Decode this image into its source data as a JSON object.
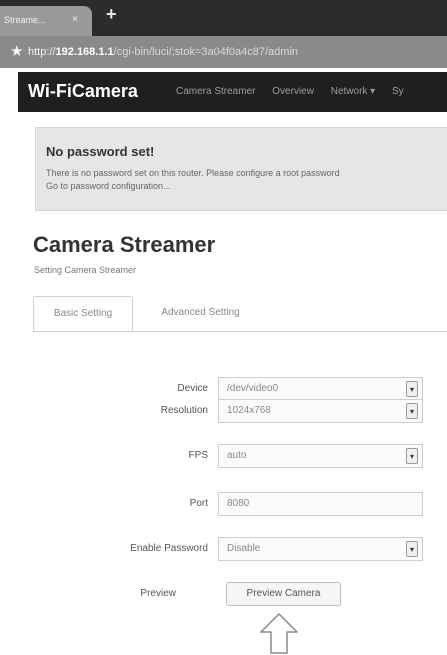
{
  "browser": {
    "tab_title": "Streame...",
    "tab_close": "×",
    "new_tab": "+",
    "star_icon": "★",
    "url_scheme": "http://",
    "url_host": "192.168.1.1",
    "url_rest": "/cgi-bin/luci/;stok=3a04f0a4c87/admin"
  },
  "navbar": {
    "brand": "Wi-FiCamera",
    "links": [
      "Camera Streamer",
      "Overview",
      "Network ▾",
      "Sy"
    ]
  },
  "alert": {
    "title": "No password set!",
    "text": "There is no password set on this router. Please configure a root password",
    "link": "Go to password configuration..."
  },
  "page": {
    "title": "Camera Streamer",
    "description": "Setting Camera Streamer"
  },
  "tabs": {
    "basic": "Basic Setting",
    "advanced": "Advanced Setting"
  },
  "form": {
    "device_label": "Device",
    "device_value": "/dev/video0",
    "resolution_label": "Resolution",
    "resolution_value": "1024x768",
    "fps_label": "FPS",
    "fps_value": "auto",
    "port_label": "Port",
    "port_value": "8080",
    "enable_password_label": "Enable Password",
    "enable_password_value": "Disable",
    "preview_label": "Preview",
    "preview_button": "Preview Camera"
  },
  "icons": {
    "select_arrow": "▾"
  }
}
